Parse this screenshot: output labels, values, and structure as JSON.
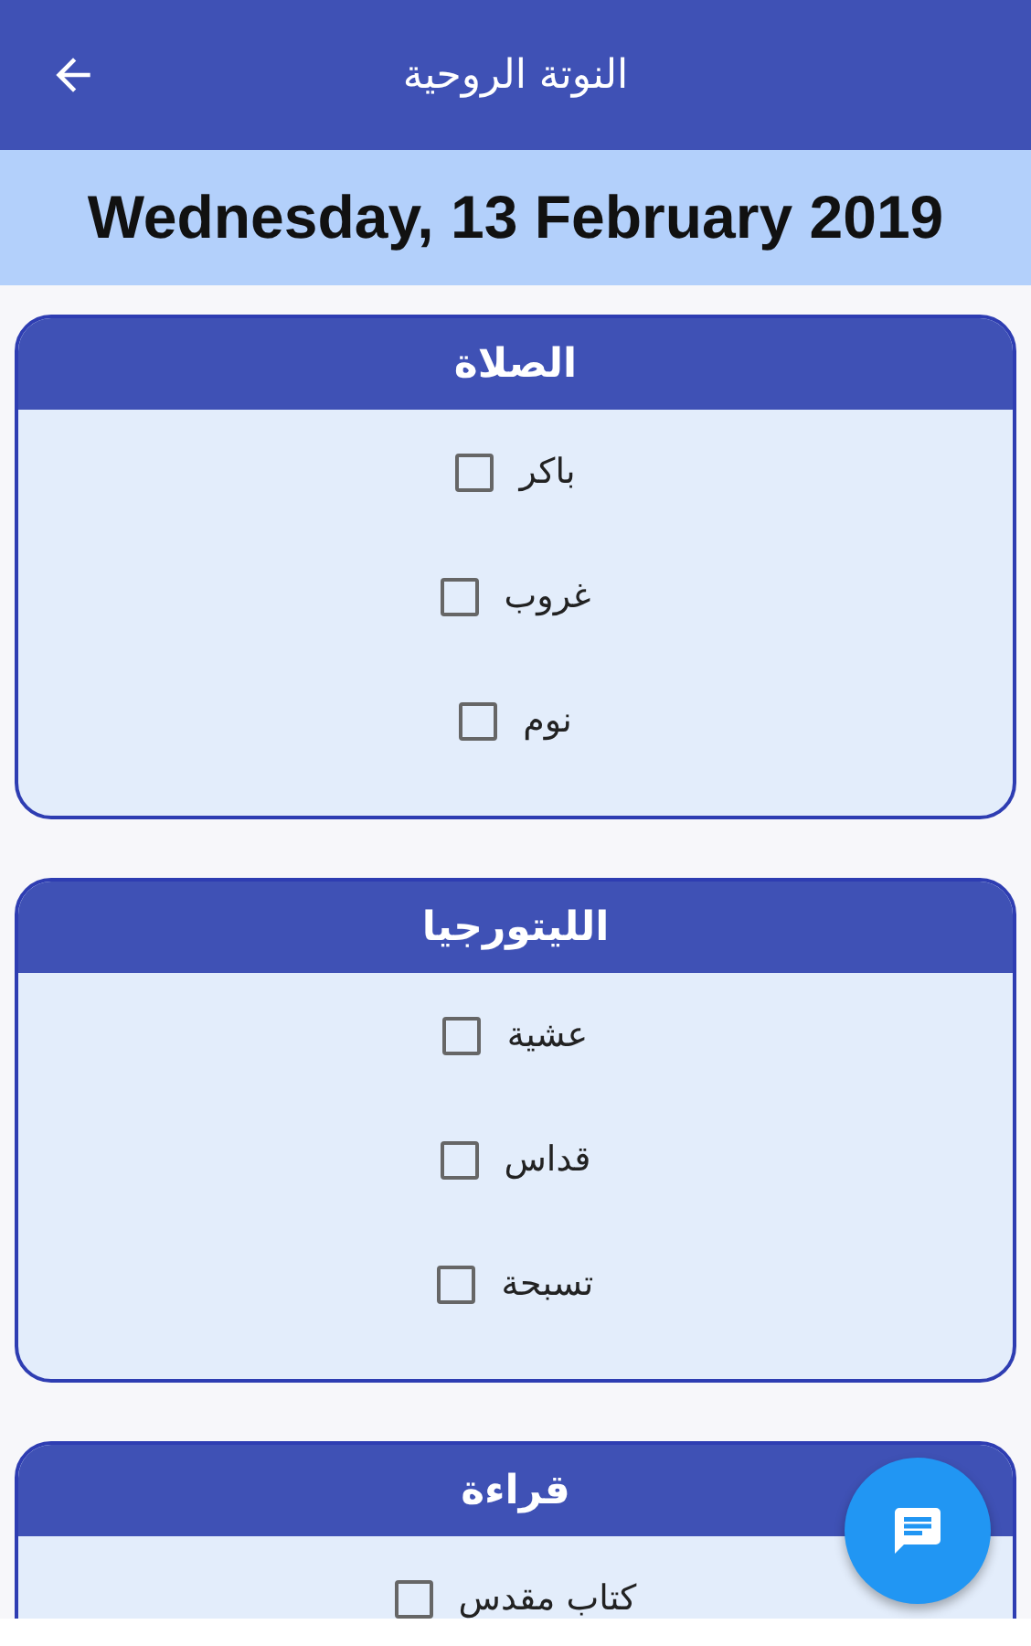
{
  "app_bar": {
    "title": "النوتة الروحية"
  },
  "date": "Wednesday, 13 February 2019",
  "sections": [
    {
      "title": "الصلاة",
      "items": [
        {
          "label": "باكر",
          "checked": false
        },
        {
          "label": "غروب",
          "checked": false
        },
        {
          "label": "نوم",
          "checked": false
        }
      ]
    },
    {
      "title": "الليتورجيا",
      "items": [
        {
          "label": "عشية",
          "checked": false
        },
        {
          "label": "قداس",
          "checked": false
        },
        {
          "label": "تسبحة",
          "checked": false
        }
      ]
    },
    {
      "title": "قراءة",
      "items": [
        {
          "label": "كتاب مقدس",
          "checked": false
        }
      ]
    }
  ]
}
